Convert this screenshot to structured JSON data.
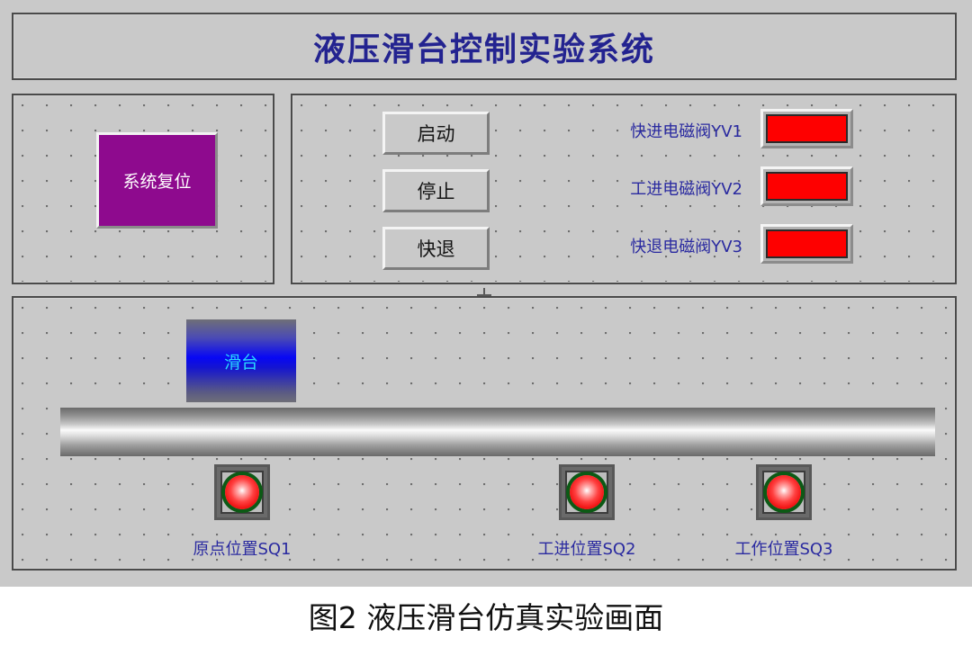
{
  "header": {
    "title": "液压滑台控制实验系统"
  },
  "reset_panel": {
    "reset_label": "系统复位",
    "color": "#8e0a8e"
  },
  "control_panel": {
    "buttons": [
      {
        "label": "启动",
        "name": "start-button"
      },
      {
        "label": "停止",
        "name": "stop-button"
      },
      {
        "label": "快退",
        "name": "fast-retract-button"
      }
    ],
    "valves": [
      {
        "label": "快进电磁阀YV1",
        "state_color": "#fe0000"
      },
      {
        "label": "工进电磁阀YV2",
        "state_color": "#fe0000"
      },
      {
        "label": "快退电磁阀YV3",
        "state_color": "#fe0000"
      }
    ]
  },
  "simulation_panel": {
    "slider_label": "滑台",
    "sensors": [
      {
        "label": "原点位置SQ1",
        "lamp_color": "#ff4141",
        "ring_color": "#0c5a15"
      },
      {
        "label": "工进位置SQ2",
        "lamp_color": "#ff4141",
        "ring_color": "#0c5a15"
      },
      {
        "label": "工作位置SQ3",
        "lamp_color": "#ff4141",
        "ring_color": "#0c5a15"
      }
    ]
  },
  "caption": {
    "text": "图2   液压滑台仿真实验画面"
  },
  "colors": {
    "background": "#c9c9c9",
    "title_text": "#232390",
    "label_text": "#2a2aa0",
    "slider_text": "#29d8ff",
    "panel_border": "#4a4a4a"
  }
}
